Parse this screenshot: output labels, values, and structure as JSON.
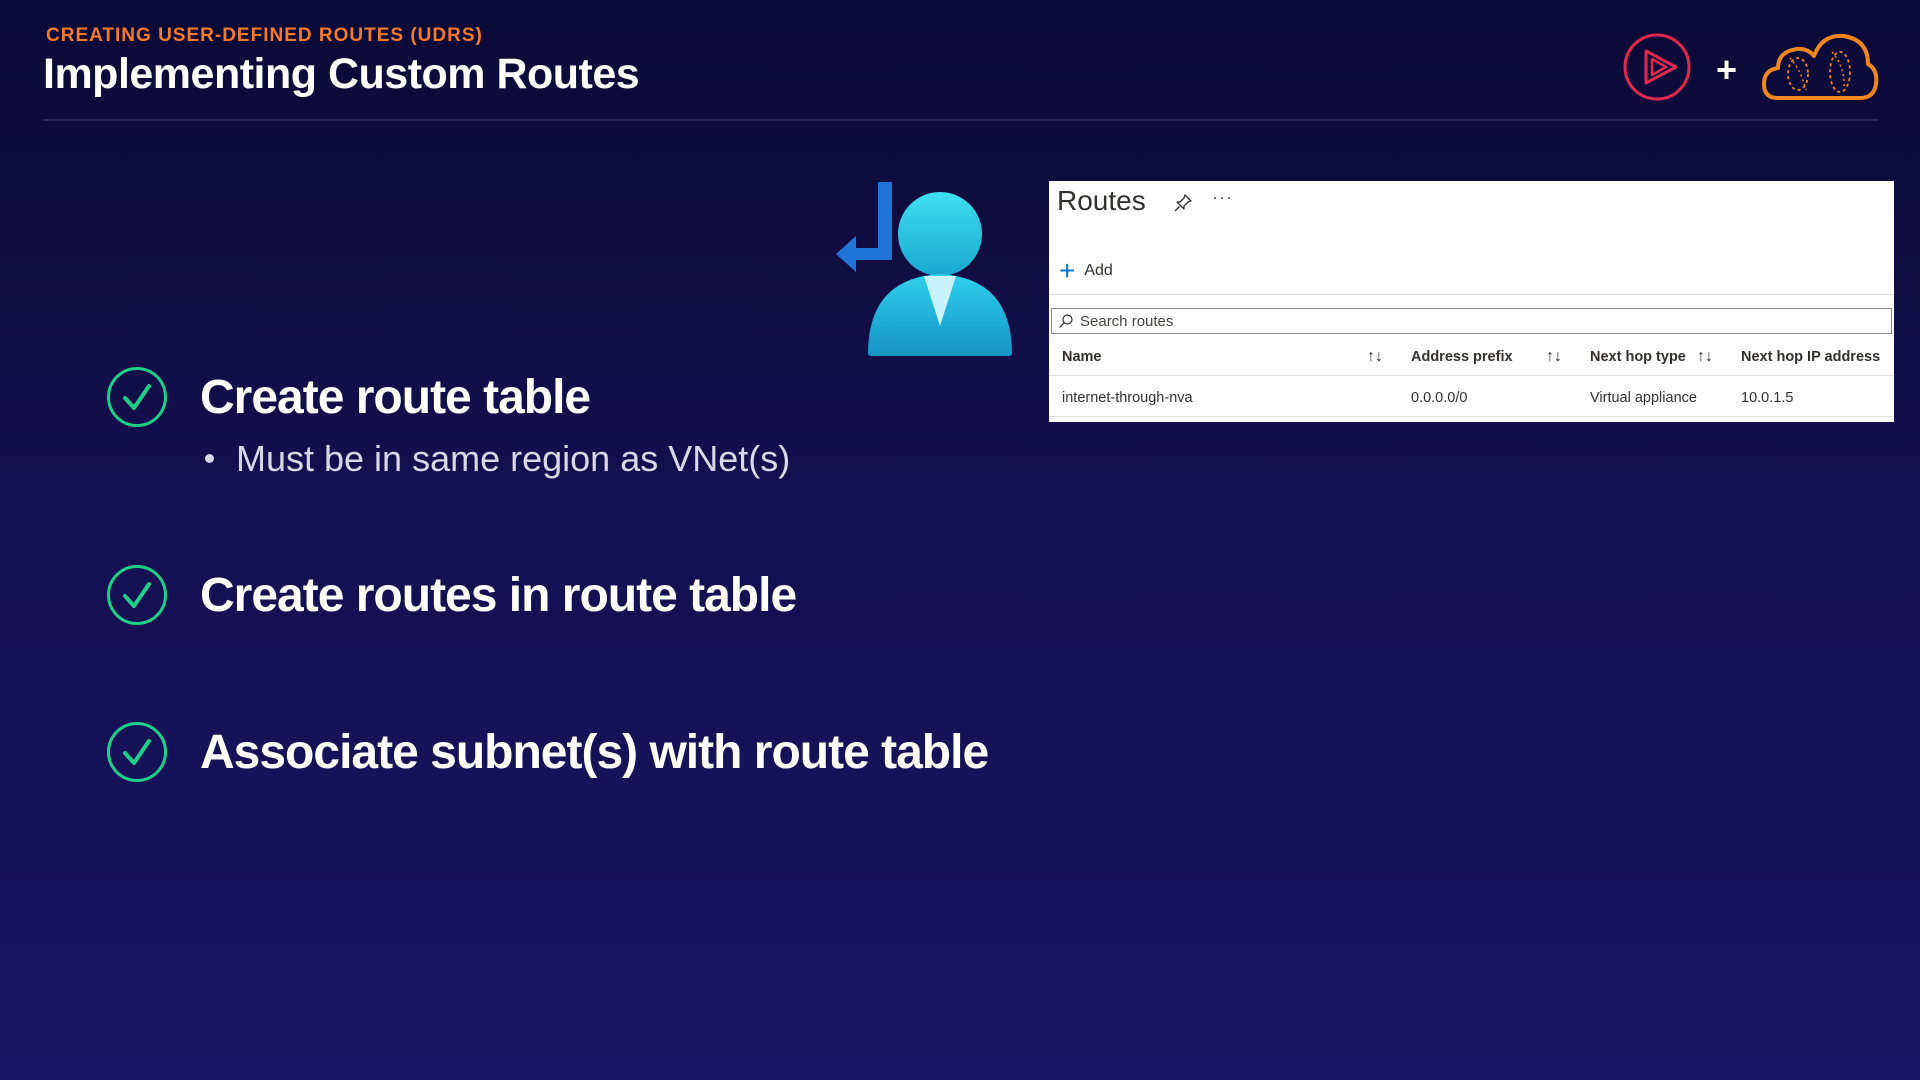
{
  "header": {
    "eyebrow": "CREATING USER-DEFINED ROUTES (UDRS)",
    "title": "Implementing Custom Routes",
    "plus": "+"
  },
  "steps": [
    {
      "label": "Create route table",
      "done": true,
      "sub": [
        "Must be in same region as VNet(s)"
      ]
    },
    {
      "label": "Create routes in route table",
      "done": true
    },
    {
      "label": "Associate subnet(s) with route table",
      "done": true
    }
  ],
  "routes_panel": {
    "title": "Routes",
    "more": "···",
    "add_label": "Add",
    "search_placeholder": "Search routes",
    "columns": [
      "Name",
      "Address prefix",
      "Next hop type",
      "Next hop IP address"
    ],
    "sort_glyph": "↑↓",
    "rows": [
      {
        "name": "internet-through-nva",
        "address_prefix": "0.0.0.0/0",
        "next_hop_type": "Virtual appliance",
        "next_hop_ip": "10.0.1.5"
      }
    ]
  },
  "colors": {
    "eyebrow": "#f47a2a",
    "check": "#1ecf8a",
    "brand_play": "#e0284f",
    "brand_cloud": "#f0861e",
    "azure_blue": "#0078d4"
  },
  "icons": [
    "pluralsight-play-icon",
    "cloud-brand-icon",
    "check-circle-icon",
    "user-route-icon",
    "pin-icon",
    "more-icon",
    "add-icon",
    "search-icon",
    "sort-icon"
  ]
}
